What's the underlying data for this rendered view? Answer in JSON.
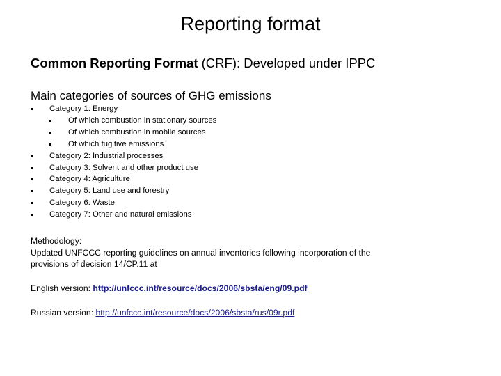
{
  "slide": {
    "title": "Reporting format",
    "subtitle": {
      "bold_part": "Common Reporting Format",
      "rest": " (CRF): Developed under IPPC"
    },
    "section_heading": "Main categories of sources of GHG emissions",
    "categories": [
      {
        "label": "Category 1: Energy",
        "level": 1
      },
      {
        "label": "Of which combustion in stationary sources",
        "level": 2
      },
      {
        "label": "Of which combustion in mobile sources",
        "level": 2
      },
      {
        "label": "Of which fugitive emissions",
        "level": 2
      },
      {
        "label": "Category 2: Industrial processes",
        "level": 1
      },
      {
        "label": "Category 3: Solvent and other product use",
        "level": 1
      },
      {
        "label": "Category 4: Agriculture",
        "level": 1
      },
      {
        "label": "Category 5: Land use and forestry",
        "level": 1
      },
      {
        "label": "Category 6: Waste",
        "level": 1
      },
      {
        "label": "Category 7: Other and natural emissions",
        "level": 1
      }
    ],
    "methodology": {
      "label": "Methodology:",
      "line1": "Updated UNFCCC reporting guidelines on annual inventories following incorporation of the",
      "line2": "provisions of decision 14/CP.11  at"
    },
    "links": {
      "english": {
        "label": "English version: ",
        "url_text": "http://unfccc.int/resource/docs/2006/sbsta/eng/09.pdf"
      },
      "russian": {
        "label": "Russian version: ",
        "url_text": "http://unfccc.int/resource/docs/2006/sbsta/rus/09r.pdf"
      }
    },
    "colors": {
      "link": "#1a1a8c",
      "text": "#000000",
      "background": "#ffffff"
    }
  }
}
